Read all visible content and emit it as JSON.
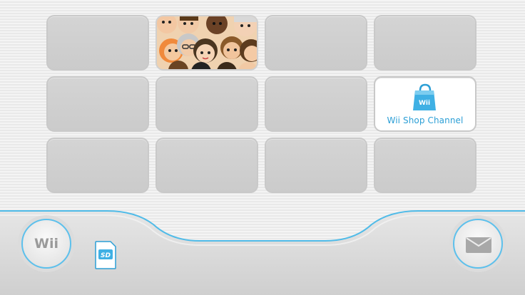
{
  "channels": {
    "mii_channel": {
      "icon": "mii-faces-collage"
    },
    "shop_channel": {
      "label": "Wii Shop Channel",
      "icon": "shopping-bag-icon",
      "bag_text": "Wii"
    }
  },
  "bottom_bar": {
    "wii_button": {
      "label": "Wii"
    },
    "sd_card": {
      "label": "SD",
      "icon": "sd-card-icon"
    },
    "mail_button": {
      "icon": "envelope-icon"
    }
  },
  "colors": {
    "accent": "#3fb4e5",
    "shop_text": "#2c9fd6",
    "tile": "#cfcfcf"
  }
}
